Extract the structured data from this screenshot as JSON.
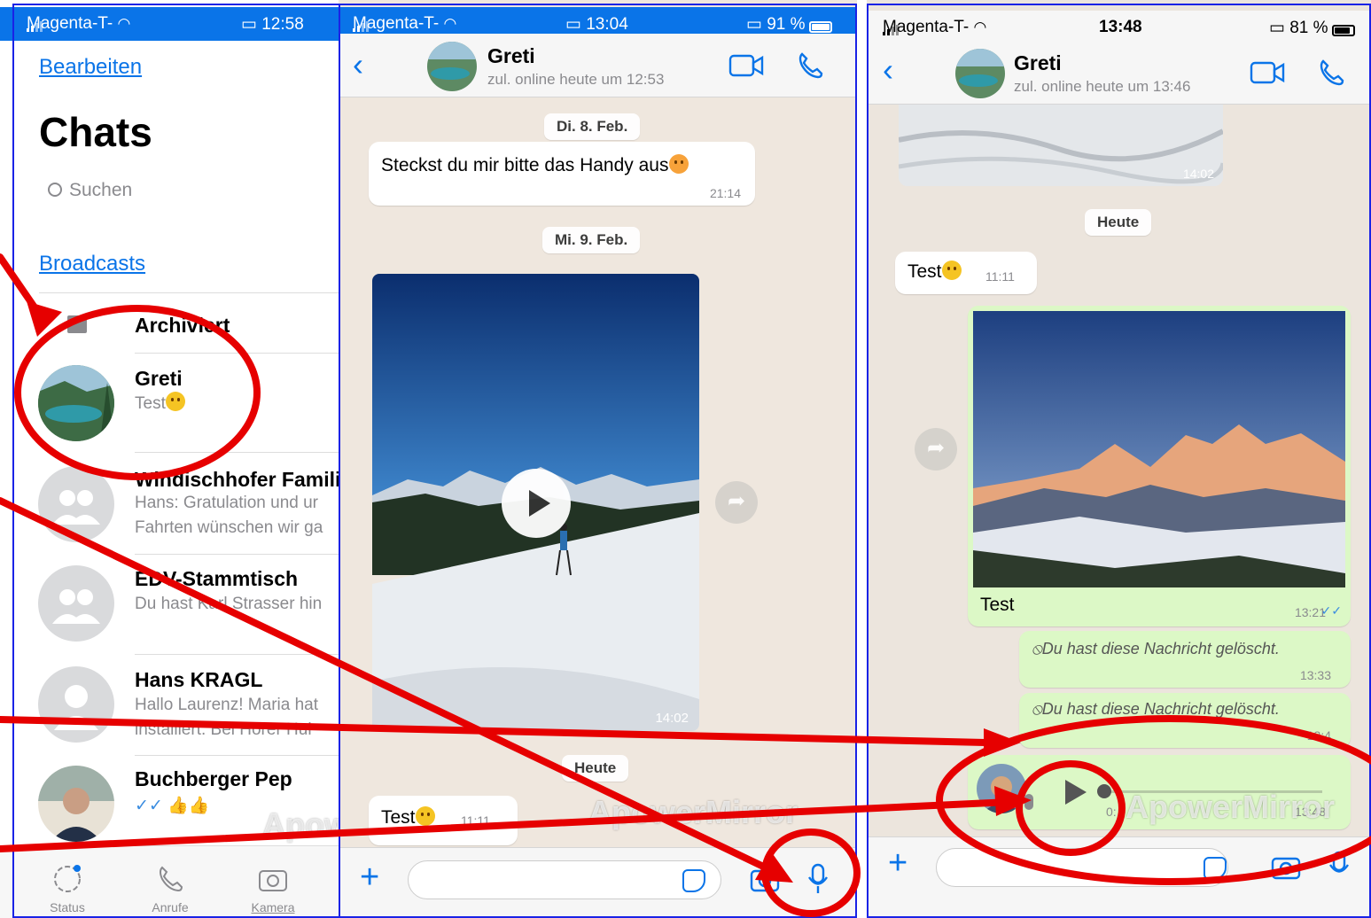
{
  "colors": {
    "accent": "#0a74e8",
    "annotation": "#e60000",
    "frame": "#1a23e6",
    "outgoing_bubble": "#dcf8c6"
  },
  "panel1": {
    "status": {
      "carrier": "Magenta-T-",
      "time": "12:58"
    },
    "edit_label": "Bearbeiten",
    "title": "Chats",
    "search_placeholder": "Suchen",
    "broadcasts_label": "Broadcasts",
    "archived_label": "Archiviert",
    "chats": [
      {
        "name": "Greti",
        "preview": "Test"
      },
      {
        "name": "Windischhofer Famili",
        "preview": "Hans: Gratulation und ur",
        "preview2": "Fahrten wünschen wir ga"
      },
      {
        "name": "EDV-Stammtisch",
        "preview": "Du hast Karl Strasser hin"
      },
      {
        "name": "Hans KRAGL",
        "preview": "Hallo Laurenz! Maria hat",
        "preview2": "installiert. Bei Horer Hul"
      },
      {
        "name": "Buchberger Pep",
        "preview": "✓✓ 👍👍"
      }
    ],
    "tabs": [
      {
        "label": "Status"
      },
      {
        "label": "Anrufe"
      },
      {
        "label": "Kamera"
      }
    ]
  },
  "panel2": {
    "status": {
      "carrier": "Magenta-T-",
      "time": "13:04",
      "battery": "91 %",
      "battery_level": 0.91
    },
    "contact": {
      "name": "Greti",
      "last_seen": "zul. online heute um 12:53"
    },
    "messages": [
      {
        "date": "Di. 8. Feb."
      },
      {
        "text": "Steckst du mir bitte das Handy aus",
        "time": "21:14"
      },
      {
        "date": "Mi. 9. Feb."
      },
      {
        "video_time": "14:02"
      },
      {
        "date": "Heute"
      },
      {
        "text": "Test",
        "time": "11:11"
      }
    ],
    "watermark": "ApowerMirror"
  },
  "panel3": {
    "status": {
      "carrier": "Magenta-T-",
      "time": "13:48",
      "battery": "81 %",
      "battery_level": 0.81
    },
    "contact": {
      "name": "Greti",
      "last_seen": "zul. online heute um 13:46"
    },
    "image_time_top": "14:02",
    "today_label": "Heute",
    "test_in": {
      "text": "Test",
      "time": "11:11"
    },
    "photo_msg": {
      "caption": "Test",
      "time": "13:21"
    },
    "deleted": [
      {
        "text": "Du hast diese Nachricht gelöscht.",
        "time": "13:33"
      },
      {
        "text": "Du hast diese Nachricht gelöscht.",
        "time": "13:4"
      }
    ],
    "voice": {
      "duration": "0:",
      "time": "13:48"
    },
    "watermark": "ApowerMirror"
  }
}
